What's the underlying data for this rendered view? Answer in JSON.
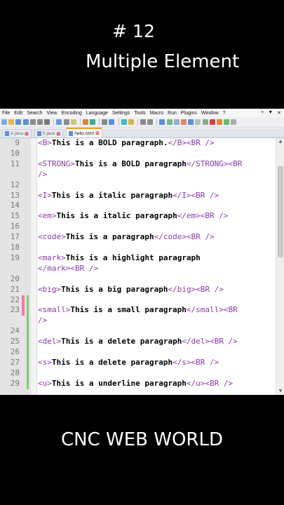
{
  "video": {
    "episode": "# 12",
    "title": "Multiple Element",
    "channel": "CNC WEB WORLD"
  },
  "menu": [
    "File",
    "Edit",
    "Search",
    "View",
    "Encoding",
    "Language",
    "Settings",
    "Tools",
    "Macro",
    "Run",
    "Plugins",
    "Window",
    "?"
  ],
  "menu_right": [
    "+",
    "▼",
    "✕"
  ],
  "tabs": [
    {
      "label": "A.java",
      "active": false
    },
    {
      "label": "5.java",
      "active": false
    },
    {
      "label": "hello.html",
      "active": true
    }
  ],
  "lines": [
    {
      "n": "9",
      "parts": [
        [
          "tag",
          "<B>"
        ],
        [
          "txt",
          "This is a BOLD paragraph."
        ],
        [
          "tag",
          "</B><BR />"
        ]
      ]
    },
    {
      "n": "10",
      "parts": []
    },
    {
      "n": "11",
      "parts": [
        [
          "tag",
          "<STRONG>"
        ],
        [
          "txt",
          "This is a BOLD paragraph"
        ],
        [
          "tag",
          "</STRONG><BR"
        ]
      ]
    },
    {
      "n": "",
      "parts": [
        [
          "tag",
          " />"
        ]
      ]
    },
    {
      "n": "12",
      "parts": []
    },
    {
      "n": "13",
      "parts": [
        [
          "tag",
          "<I>"
        ],
        [
          "txt",
          "This is a italic paragraph"
        ],
        [
          "tag",
          "</I><BR />"
        ]
      ]
    },
    {
      "n": "14",
      "parts": []
    },
    {
      "n": "15",
      "parts": [
        [
          "tag",
          "<em>"
        ],
        [
          "txt",
          "This is a italic paragraph"
        ],
        [
          "tag",
          "</em><BR />"
        ]
      ]
    },
    {
      "n": "16",
      "parts": []
    },
    {
      "n": "17",
      "parts": [
        [
          "tag",
          "<code>"
        ],
        [
          "txt",
          "This is a paragraph"
        ],
        [
          "tag",
          "</code><BR />"
        ]
      ]
    },
    {
      "n": "18",
      "parts": []
    },
    {
      "n": "19",
      "parts": [
        [
          "tag",
          "<mark>"
        ],
        [
          "txt",
          "This is a highlight paragraph"
        ]
      ]
    },
    {
      "n": "",
      "parts": [
        [
          "tag",
          "</mark><BR />"
        ]
      ]
    },
    {
      "n": "20",
      "parts": []
    },
    {
      "n": "21",
      "parts": [
        [
          "tag",
          "<big>"
        ],
        [
          "txt",
          "This is a big paragraph"
        ],
        [
          "tag",
          "</big><BR />"
        ]
      ]
    },
    {
      "n": "22",
      "parts": []
    },
    {
      "n": "23",
      "parts": [
        [
          "tag",
          "<small>"
        ],
        [
          "txt",
          "This is a small paragraph"
        ],
        [
          "tag",
          "</small><BR"
        ]
      ]
    },
    {
      "n": "",
      "parts": [
        [
          "tag",
          "/>"
        ]
      ]
    },
    {
      "n": "24",
      "parts": []
    },
    {
      "n": "25",
      "parts": [
        [
          "tag",
          "<del>"
        ],
        [
          "txt",
          "This is a delete paragraph"
        ],
        [
          "tag",
          "</del><BR />"
        ]
      ]
    },
    {
      "n": "26",
      "parts": []
    },
    {
      "n": "27",
      "parts": [
        [
          "tag",
          "<s>"
        ],
        [
          "txt",
          "This is a delete paragraph"
        ],
        [
          "tag",
          "</s><BR />"
        ]
      ]
    },
    {
      "n": "28",
      "parts": []
    },
    {
      "n": "29",
      "parts": [
        [
          "tag",
          "<u>"
        ],
        [
          "txt",
          "This is a underline paragraph"
        ],
        [
          "tag",
          "</u><BR />"
        ]
      ]
    }
  ],
  "colors": {
    "tag": "#8b3aa8",
    "text": "#000000",
    "change_marker": "#f07aa8",
    "save_marker": "#7ccf6b",
    "active_tab_accent": "#f0a030"
  }
}
